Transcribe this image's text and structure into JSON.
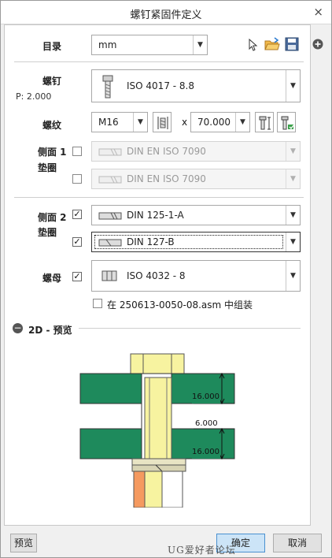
{
  "window": {
    "title": "螺钉紧固件定义",
    "close_glyph": "×"
  },
  "catalog": {
    "label": "目录",
    "value": "mm"
  },
  "screw": {
    "label": "螺钉",
    "pitch": "P: 2.000",
    "value": "ISO 4017 - 8.8"
  },
  "thread": {
    "label": "螺纹",
    "diameter": "M16",
    "times": "x",
    "length": "70.000"
  },
  "side1": {
    "label_line1": "侧面 1",
    "label_line2": "垫圈",
    "washer1": "DIN EN ISO 7090",
    "washer2": "DIN EN ISO 7090",
    "washer1_checked": false,
    "washer2_checked": false
  },
  "side2": {
    "label_line1": "侧面 2",
    "label_line2": "垫圈",
    "washer1": "DIN 125-1-A",
    "washer2": "DIN 127-B",
    "washer1_checked": true,
    "washer2_checked": true
  },
  "nut": {
    "label": "螺母",
    "value": "ISO 4032 - 8",
    "checked": true
  },
  "assemble": {
    "text": "在 250613-0050-08.asm 中组装",
    "checked": false
  },
  "preview": {
    "section_label": "2D - 预览",
    "toggle_glyph": "−",
    "dim_top": "16.000",
    "dim_gap": "6.000",
    "dim_bottom": "16.000"
  },
  "buttons": {
    "preview": "预览",
    "ok": "确定",
    "cancel": "取消"
  },
  "watermark": "UG爱好者论坛 www.UGSNX.com",
  "colors": {
    "plate": "#1e8a5c",
    "bolt": "#f7f3a0",
    "washer": "#e8e4c4",
    "nut": "#f59a60"
  }
}
